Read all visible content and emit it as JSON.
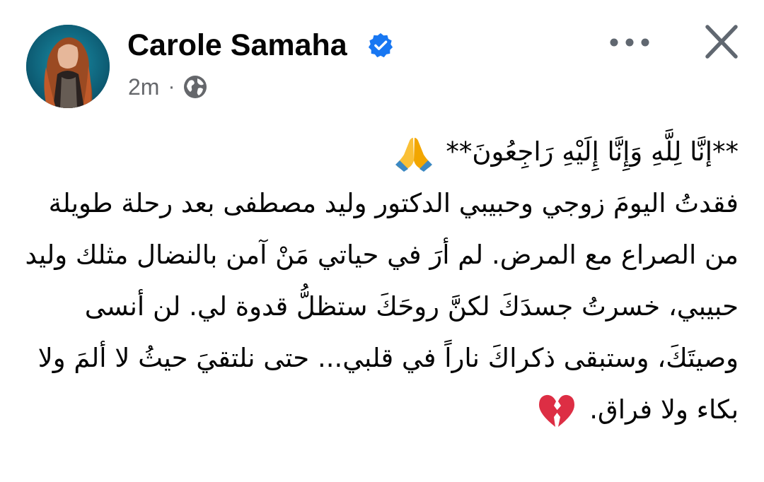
{
  "post": {
    "author": "Carole Samaha",
    "verified": true,
    "timestamp": "2m",
    "separator": "·",
    "audience_icon": "globe-icon",
    "actions": {
      "more_icon": "more-options-icon",
      "close_icon": "close-icon"
    },
    "body": {
      "line1_text": "**إنَّا لِلَّهِ وَإِنَّا إِلَيْهِ رَاجِعُونَ**",
      "line1_emoji": "folded-hands-emoji",
      "paragraph1": "فقدتُ اليومَ زوجي وحبيبي الدكتور وليد مصطفى بعد رحلة طويلة من الصراع مع المرض. لم أرَ في حياتي مَنْ آمن بالنضال مثلك وليد",
      "paragraph2_text": "حبيبي، خسرتُ جسدَكَ لكنَّ روحَكَ ستظلُّ قدوة لي. لن أنسى وصيتَكَ، وستبقى ذكراكَ ناراً في قلبي... حتى نلتقيَ حيثُ لا ألمَ ولا بكاء ولا فراق.",
      "paragraph2_emoji": "broken-heart-emoji"
    }
  },
  "colors": {
    "text_primary": "#050505",
    "text_secondary": "#65676b",
    "verified_badge": "#1877f2",
    "icon_gray": "#606770",
    "heart_red": "#dd2e44",
    "hands_blue": "#3b88c3",
    "hands_skin": "#fac036"
  }
}
